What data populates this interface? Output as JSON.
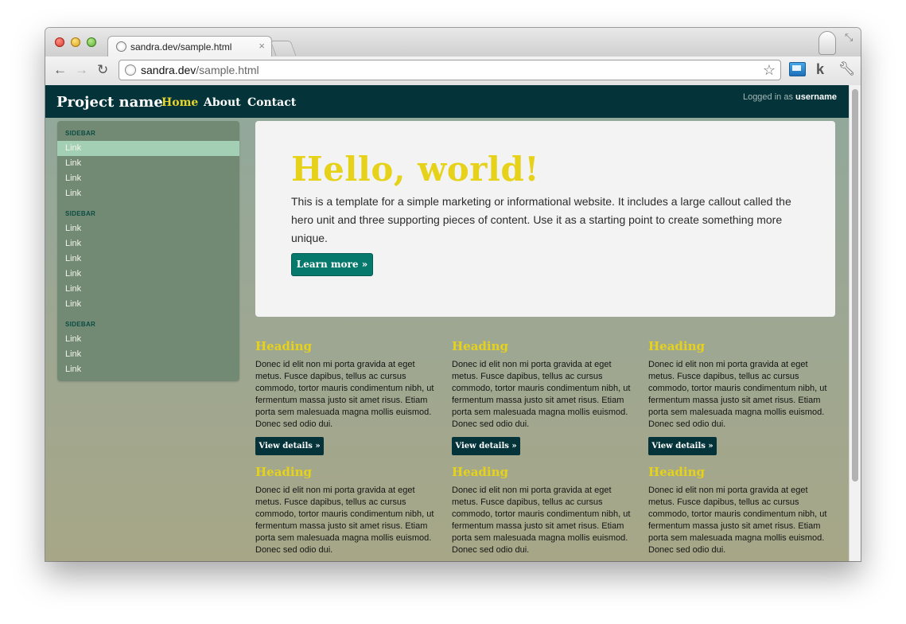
{
  "browser": {
    "tab_title": "sandra.dev/sample.html",
    "tab_close": "×",
    "url_host": "sandra.dev",
    "url_path": "/sample.html",
    "icons": [
      "globe-icon",
      "back-arrow-icon",
      "forward-arrow-icon",
      "reload-icon",
      "star-icon",
      "extension-icon",
      "k-icon",
      "wrench-icon",
      "fullscreen-icon",
      "profile-icon"
    ]
  },
  "navbar": {
    "brand": "Project name",
    "links": [
      "Home",
      "About",
      "Contact"
    ],
    "login_prefix": "Logged in as",
    "username": "username"
  },
  "sidebar": {
    "groups": [
      {
        "header": "SIDEBAR",
        "links": [
          "Link",
          "Link",
          "Link",
          "Link"
        ]
      },
      {
        "header": "SIDEBAR",
        "links": [
          "Link",
          "Link",
          "Link",
          "Link",
          "Link",
          "Link"
        ]
      },
      {
        "header": "SIDEBAR",
        "links": [
          "Link",
          "Link",
          "Link"
        ]
      }
    ],
    "active_color": "#a3d0b5"
  },
  "hero": {
    "title": "Hello, world!",
    "text": "This is a template for a simple marketing or informational website. It includes a large callout called the hero unit and three supporting pieces of content. Use it as a starting point to create something more unique.",
    "button": "Learn more »"
  },
  "cards": [
    {
      "heading": "Heading",
      "text": "Donec id elit non mi porta gravida at eget metus. Fusce dapibus, tellus ac cursus commodo, tortor mauris condimentum nibh, ut fermentum massa justo sit amet risus. Etiam porta sem malesuada magna mollis euismod. Donec sed odio dui.",
      "button": "View details »"
    },
    {
      "heading": "Heading",
      "text": "Donec id elit non mi porta gravida at eget metus. Fusce dapibus, tellus ac cursus commodo, tortor mauris condimentum nibh, ut fermentum massa justo sit amet risus. Etiam porta sem malesuada magna mollis euismod. Donec sed odio dui.",
      "button": "View details »"
    },
    {
      "heading": "Heading",
      "text": "Donec id elit non mi porta gravida at eget metus. Fusce dapibus, tellus ac cursus commodo, tortor mauris condimentum nibh, ut fermentum massa justo sit amet risus. Etiam porta sem malesuada magna mollis euismod. Donec sed odio dui.",
      "button": "View details »"
    },
    {
      "heading": "Heading",
      "text": "Donec id elit non mi porta gravida at eget metus. Fusce dapibus, tellus ac cursus commodo, tortor mauris condimentum nibh, ut fermentum massa justo sit amet risus. Etiam porta sem malesuada magna mollis euismod. Donec sed odio dui."
    },
    {
      "heading": "Heading",
      "text": "Donec id elit non mi porta gravida at eget metus. Fusce dapibus, tellus ac cursus commodo, tortor mauris condimentum nibh, ut fermentum massa justo sit amet risus. Etiam porta sem malesuada magna mollis euismod. Donec sed odio dui."
    },
    {
      "heading": "Heading",
      "text": "Donec id elit non mi porta gravida at eget metus. Fusce dapibus, tellus ac cursus commodo, tortor mauris condimentum nibh, ut fermentum massa justo sit amet risus. Etiam porta sem malesuada magna mollis euismod. Donec sed odio dui."
    }
  ],
  "colors": {
    "navbar": "#04343a",
    "accent_yellow": "#e6d21a",
    "hero_button": "#07786c",
    "sidebar": "#728a73"
  }
}
